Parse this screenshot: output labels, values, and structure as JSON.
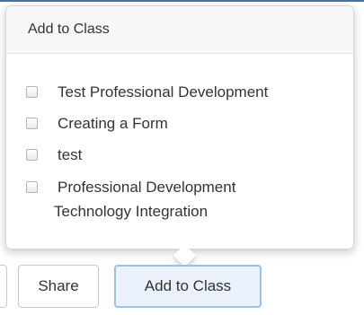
{
  "popover": {
    "title": "Add to Class",
    "options": [
      {
        "label": "Test Professional Development",
        "checked": false
      },
      {
        "label": "Creating a Form",
        "checked": false
      },
      {
        "label": "test",
        "checked": false
      },
      {
        "label_line1": "Professional Development",
        "label_line2": "Technology Integration",
        "checked": false
      }
    ]
  },
  "toolbar": {
    "share_label": "Share",
    "add_to_class_label": "Add to Class"
  },
  "colors": {
    "accent_border": "#9fc0e6",
    "active_button_bg": "#eaf1fb"
  }
}
